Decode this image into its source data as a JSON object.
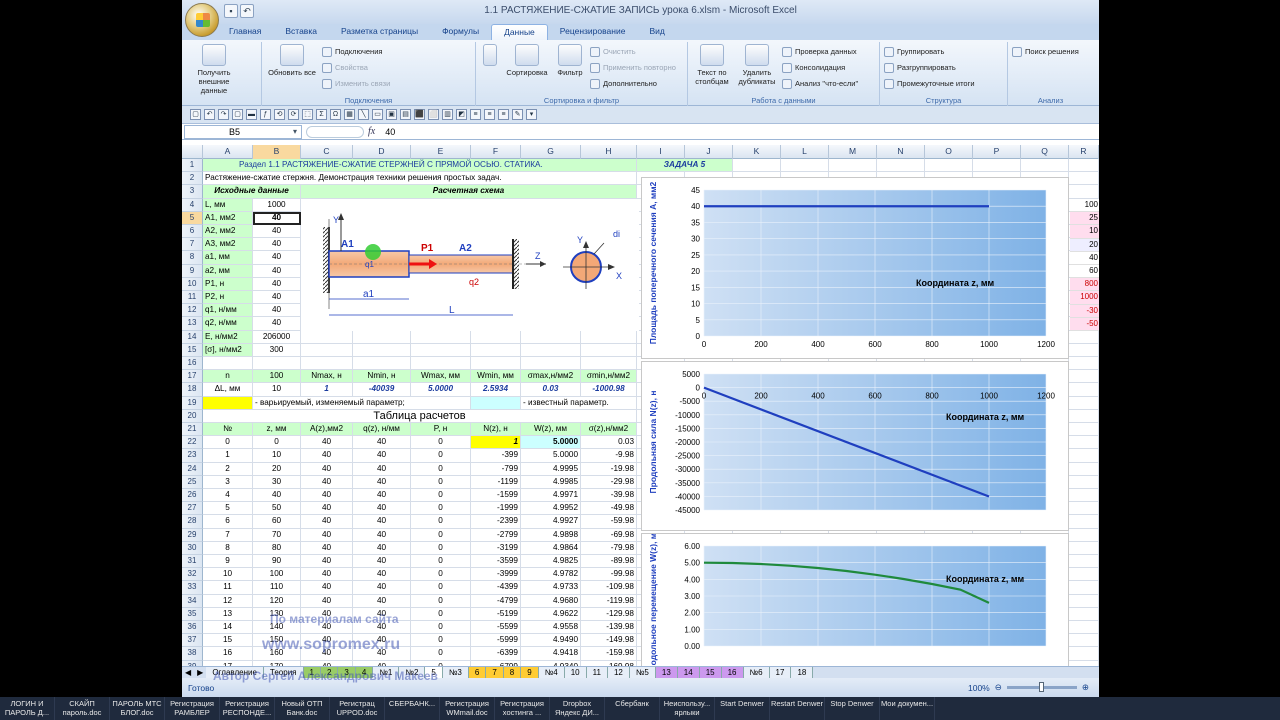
{
  "window": {
    "title": "1.1 РАСТЯЖЕНИЕ-СЖАТИЕ ЗАПИСЬ урока 6.xlsm - Microsoft Excel"
  },
  "tabs": [
    "Главная",
    "Вставка",
    "Разметка страницы",
    "Формулы",
    "Данные",
    "Рецензирование",
    "Вид"
  ],
  "active_tab": "Данные",
  "ribbon": {
    "ext_data": "Получить внешние данные",
    "refresh": "Обновить все",
    "connections": "Подключения",
    "properties": "Свойства",
    "edit_links": "Изменить связи",
    "grp_connections": "Подключения",
    "sort": "Сортировка",
    "filter": "Фильтр",
    "clear": "Очистить",
    "reapply": "Применить повторно",
    "advanced": "Дополнительно",
    "grp_sort": "Сортировка и фильтр",
    "text_to_cols": "Текст по столбцам",
    "remove_dup": "Удалить дубликаты",
    "validation": "Проверка данных",
    "consolidate": "Консолидация",
    "whatif": "Анализ \"что-если\"",
    "grp_data": "Работа с данными",
    "group": "Группировать",
    "ungroup": "Разгруппировать",
    "subtotal": "Промежуточные итоги",
    "grp_outline": "Структура",
    "solver": "Поиск решения",
    "grp_analysis": "Анализ"
  },
  "formula_bar": {
    "name_box": "B5",
    "fx": "fx",
    "value": "40"
  },
  "columns": [
    "A",
    "B",
    "C",
    "D",
    "E",
    "F",
    "G",
    "H",
    "I",
    "J",
    "K",
    "L",
    "M",
    "N",
    "O",
    "P",
    "Q",
    "R"
  ],
  "cells": {
    "r1": "Раздел 1.1  РАСТЯЖЕНИЕ-СЖАТИЕ СТЕРЖНЕЙ С ПРЯМОЙ ОСЬЮ. СТАТИКА.",
    "r1_task": "ЗАДАЧА 5",
    "r2": "Растяжение-сжатие стержня. Демонстрация техники решения простых задач.",
    "r3_a": "Исходные данные",
    "r3_c": "Расчетная схема",
    "params": [
      [
        "L, мм",
        "1000"
      ],
      [
        "A1, мм2",
        "40"
      ],
      [
        "A2, мм2",
        "40"
      ],
      [
        "A3, мм2",
        "40"
      ],
      [
        "a1, мм",
        "40"
      ],
      [
        "a2, мм",
        "40"
      ],
      [
        "P1, н",
        "40"
      ],
      [
        "P2, н",
        "40"
      ],
      [
        "q1, н/мм",
        "40"
      ],
      [
        "q2, н/мм",
        "40"
      ],
      [
        "E, н/мм2",
        "206000"
      ],
      [
        "[σ], н/мм2",
        "300"
      ]
    ],
    "r17": [
      "n",
      "100",
      "Nmax, н",
      "Nmin, н",
      "Wmax, мм",
      "Wmin, мм",
      "σmax,н/мм2",
      "σmin,н/мм2"
    ],
    "r18": [
      "ΔL, мм",
      "10",
      "1",
      "-40039",
      "5.0000",
      "2.5934",
      "0.03",
      "-1000.98"
    ],
    "r19_var": "- варьируемый, изменяемый параметр;",
    "r19_known": "- известный параметр.",
    "r20": "Таблица расчетов",
    "r21": [
      "№",
      "z, мм",
      "A(z),мм2",
      "q(z), н/мм",
      "P, н",
      "N(z), н",
      "W(z), мм",
      "σ(z),н/мм2"
    ],
    "table": [
      [
        "0",
        "0",
        "40",
        "40",
        "0",
        "1",
        "5.0000",
        "0.03"
      ],
      [
        "1",
        "10",
        "40",
        "40",
        "0",
        "-399",
        "5.0000",
        "-9.98"
      ],
      [
        "2",
        "20",
        "40",
        "40",
        "0",
        "-799",
        "4.9995",
        "-19.98"
      ],
      [
        "3",
        "30",
        "40",
        "40",
        "0",
        "-1199",
        "4.9985",
        "-29.98"
      ],
      [
        "4",
        "40",
        "40",
        "40",
        "0",
        "-1599",
        "4.9971",
        "-39.98"
      ],
      [
        "5",
        "50",
        "40",
        "40",
        "0",
        "-1999",
        "4.9952",
        "-49.98"
      ],
      [
        "6",
        "60",
        "40",
        "40",
        "0",
        "-2399",
        "4.9927",
        "-59.98"
      ],
      [
        "7",
        "70",
        "40",
        "40",
        "0",
        "-2799",
        "4.9898",
        "-69.98"
      ],
      [
        "8",
        "80",
        "40",
        "40",
        "0",
        "-3199",
        "4.9864",
        "-79.98"
      ],
      [
        "9",
        "90",
        "40",
        "40",
        "0",
        "-3599",
        "4.9825",
        "-89.98"
      ],
      [
        "10",
        "100",
        "40",
        "40",
        "0",
        "-3999",
        "4.9782",
        "-99.98"
      ],
      [
        "11",
        "110",
        "40",
        "40",
        "0",
        "-4399",
        "4.9733",
        "-109.98"
      ],
      [
        "12",
        "120",
        "40",
        "40",
        "0",
        "-4799",
        "4.9680",
        "-119.98"
      ],
      [
        "13",
        "130",
        "40",
        "40",
        "0",
        "-5199",
        "4.9622",
        "-129.98"
      ],
      [
        "14",
        "140",
        "40",
        "40",
        "0",
        "-5599",
        "4.9558",
        "-139.98"
      ],
      [
        "15",
        "150",
        "40",
        "40",
        "0",
        "-5999",
        "4.9490",
        "-149.98"
      ],
      [
        "16",
        "160",
        "40",
        "40",
        "0",
        "-6399",
        "4.9418",
        "-159.98"
      ],
      [
        "17",
        "170",
        "40",
        "40",
        "0",
        "-6799",
        "4.9340",
        "-169.98"
      ]
    ]
  },
  "scheme": {
    "y": "Y",
    "a1": "A1",
    "q1": "q1",
    "p1": "P1",
    "a2": "A2",
    "q2": "q2",
    "z": "Z",
    "len_a1": "a1",
    "len_L": "L",
    "y2": "Y",
    "di": "di",
    "x": "X"
  },
  "right_values": [
    "100",
    "25",
    "10",
    "20",
    "40",
    "60",
    "800",
    "1000",
    "-30",
    "-50"
  ],
  "sheet_tabs": [
    "Оглавление",
    "Теория",
    "1",
    "2",
    "3",
    "4",
    "№1",
    "№2",
    "5",
    "№3",
    "6",
    "7",
    "8",
    "9",
    "№4",
    "10",
    "11",
    "12",
    "№5",
    "13",
    "14",
    "15",
    "16",
    "№6",
    "17",
    "18"
  ],
  "status": {
    "ready": "Готово",
    "zoom": "100%"
  },
  "watermark": {
    "line1": "По материалам сайта",
    "line2": "www.sopromex.ru",
    "line3": "Автор Сергей Александрович Макеев"
  },
  "taskbar": [
    "ЛОГИН И ПАРОЛЬ Д...",
    "СКАЙП пароль.doc",
    "ПАРОЛЬ МТС БЛОГ.doc",
    "Регистрация РАМБЛЕР",
    "Регистрация РЕСПОНДЕ...",
    "Новый ОТП Банк.doc",
    "Регистрац UPPOD.doc",
    "СБЕРБАНК...",
    "Регистрация WMmail.doc",
    "Регистрация хостинга ...",
    "Dropbox Яндекс ДИ...",
    "Сбербанк",
    "Неиспользу... ярлыки",
    "Start Denwer",
    "Restart Denwer",
    "Stop Denwer",
    "Мои докумен..."
  ],
  "chart_data": [
    {
      "type": "line",
      "ylabel": "Площадь поперечного сечения A, мм2",
      "xlabel": "Координата z, мм",
      "xlim": [
        0,
        1200
      ],
      "ylim": [
        0,
        45
      ],
      "xticks": [
        0,
        200,
        400,
        600,
        800,
        1000,
        1200
      ],
      "yticks": [
        0,
        5,
        10,
        15,
        20,
        25,
        30,
        35,
        40,
        45
      ],
      "series": [
        {
          "x": [
            0,
            1000
          ],
          "y": [
            40,
            40
          ],
          "color": "#1f3fbf"
        }
      ]
    },
    {
      "type": "line",
      "ylabel": "Продольная сила N(z), н",
      "xlabel": "Координата z, мм",
      "xlim": [
        0,
        1200
      ],
      "ylim": [
        -45000,
        5000
      ],
      "xticks": [
        0,
        200,
        400,
        600,
        800,
        1000,
        1200
      ],
      "yticks": [
        5000,
        0,
        -5000,
        -10000,
        -15000,
        -20000,
        -25000,
        -30000,
        -35000,
        -40000,
        -45000
      ],
      "series": [
        {
          "x": [
            0,
            1000
          ],
          "y": [
            1,
            -40039
          ],
          "color": "#1f3fbf"
        }
      ]
    },
    {
      "type": "line",
      "ylabel": "одольное перемещение W(z), мм",
      "xlabel": "Координата z, мм",
      "xlim": [
        0,
        1200
      ],
      "ylim": [
        0,
        6
      ],
      "yticks": [
        "0.00",
        "1.00",
        "2.00",
        "3.00",
        "4.00",
        "5.00",
        "6.00"
      ],
      "series": [
        {
          "x": [
            0,
            100,
            200,
            300,
            400,
            500,
            600,
            700,
            800,
            900,
            1000
          ],
          "y": [
            5.0,
            4.98,
            4.92,
            4.82,
            4.68,
            4.5,
            4.28,
            4.02,
            3.72,
            3.38,
            2.59
          ],
          "color": "#1f8a3c"
        }
      ]
    }
  ]
}
